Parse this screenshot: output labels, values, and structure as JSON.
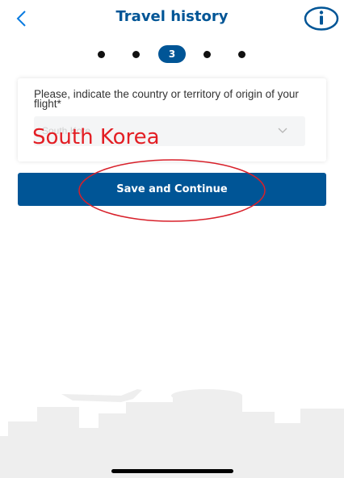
{
  "header": {
    "title": "Travel history",
    "back_icon": "chevron-left-icon",
    "info_icon": "info-icon"
  },
  "stepper": {
    "total_steps": 5,
    "current_step": 3,
    "current_label": "3"
  },
  "form": {
    "question": "Please, indicate the country or territory of origin of your flight*",
    "country_select": {
      "value": "South Kore",
      "icon": "chevron-down-icon"
    }
  },
  "annotation": {
    "typed_text": "South Korea",
    "color": "#e31e24"
  },
  "save_button": {
    "label": "Save and Continue"
  },
  "colors": {
    "brand": "#005596",
    "background": "#ffffff",
    "field": "#f4f5f6",
    "skyline": "#eeeeee"
  }
}
